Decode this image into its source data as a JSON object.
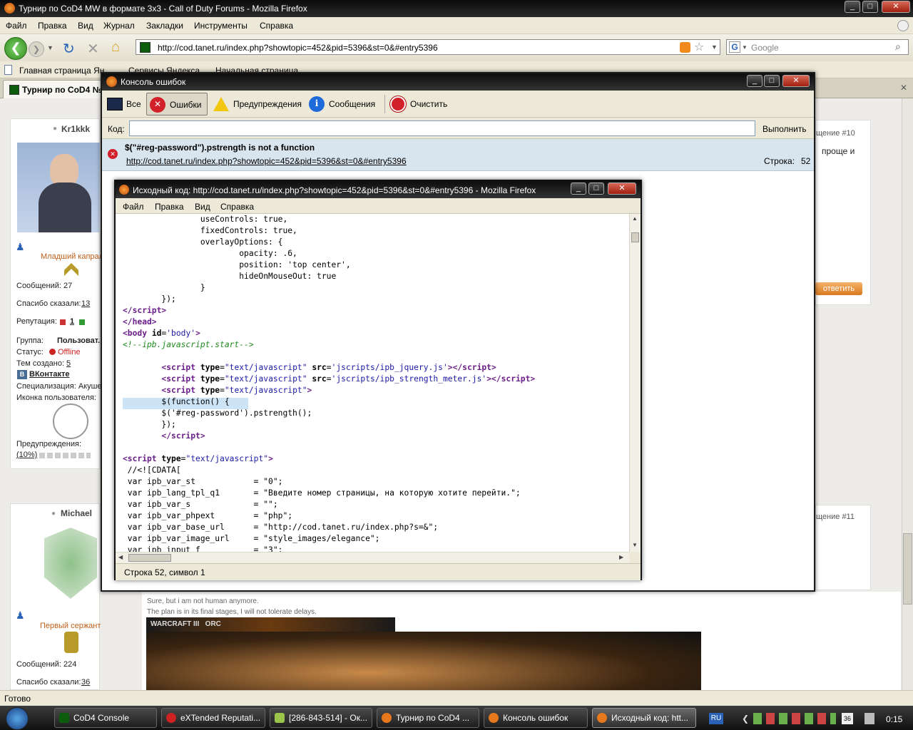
{
  "browser": {
    "title": "Турнир по CoD4 MW в формате 3х3 - Call of Duty Forums - Mozilla Firefox",
    "menu": [
      "Файл",
      "Правка",
      "Вид",
      "Журнал",
      "Закладки",
      "Инструменты",
      "Справка"
    ],
    "url": "http://cod.tanet.ru/index.php?showtopic=452&pid=5396&st=0&#entry5396",
    "search_placeholder": "Google",
    "bookmarks": [
      "Главная страница Ян...",
      "Сервисы Яндекса",
      "Начальная страница"
    ],
    "tab": "Турнир по CoD4 №",
    "status": "Готово"
  },
  "page": {
    "user1": {
      "name": "Kr1kkk",
      "rank": "Младший капрал",
      "messages": "Сообщений: 27",
      "thanks_label": "Спасибо сказали:",
      "thanks_value": "13",
      "rep_label": "Репутация:",
      "rep_value": "1",
      "group_label": "Группа:",
      "group_value": "Пользоват...",
      "status_label": "Статус:",
      "status_value": "Offline",
      "topics_label": "Тем создано:",
      "topics_value": "5",
      "vk": "ВКонтакте",
      "spec": "Специализация: Акуше...",
      "icon_label": "Иконка пользователя:",
      "warn_label": "Предупреждения:",
      "warn_value": "(10%)"
    },
    "user2": {
      "name": "Michael",
      "rank": "Первый сержант",
      "messages": "Сообщений: 224",
      "thanks_label": "Спасибо сказали:",
      "thanks_value": "36"
    },
    "right_snips": {
      "post10": "щение #10",
      "post10_text": "проще и",
      "reply_button": "ответить",
      "post11": "щение #11"
    },
    "signature": {
      "line1": "Sure, but i am not human anymore.",
      "line2": "The plan is in its final stages, I will not tolerate delays.",
      "banner": "WARCRAFT III   ORC"
    }
  },
  "console": {
    "title": "Консоль ошибок",
    "toolbar": [
      "Все",
      "Ошибки",
      "Предупреждения",
      "Сообщения",
      "Очистить"
    ],
    "selected": "Ошибки",
    "code_label": "Код:",
    "run_label": "Выполнить",
    "error": {
      "message": "$(\"#reg-password\").pstrength is not a function",
      "url": "http://cod.tanet.ru/index.php?showtopic=452&pid=5396&st=0&#entry5396",
      "line_label": "Строка:",
      "line_value": "52"
    }
  },
  "source": {
    "title": "Исходный код: http://cod.tanet.ru/index.php?showtopic=452&pid=5396&st=0&#entry5396 - Mozilla Firefox",
    "menu": [
      "Файл",
      "Правка",
      "Вид",
      "Справка"
    ],
    "status": "Строка 52, символ 1"
  },
  "taskbar": {
    "tasks": [
      "CoD4 Console",
      "eXTended Reputati...",
      "[286-843-514] - Ок...",
      "Турнир по CoD4 ...",
      "Консоль ошибок",
      "Исходный код: htt..."
    ],
    "lang": "RU",
    "tray_number": "36",
    "clock": "0:15"
  },
  "colors": {
    "tag": "#6c1e8a",
    "string": "#1a1aa6",
    "comment": "#1d8a1d",
    "error_row": "#d8e4ee",
    "rank": "#c0601a"
  }
}
